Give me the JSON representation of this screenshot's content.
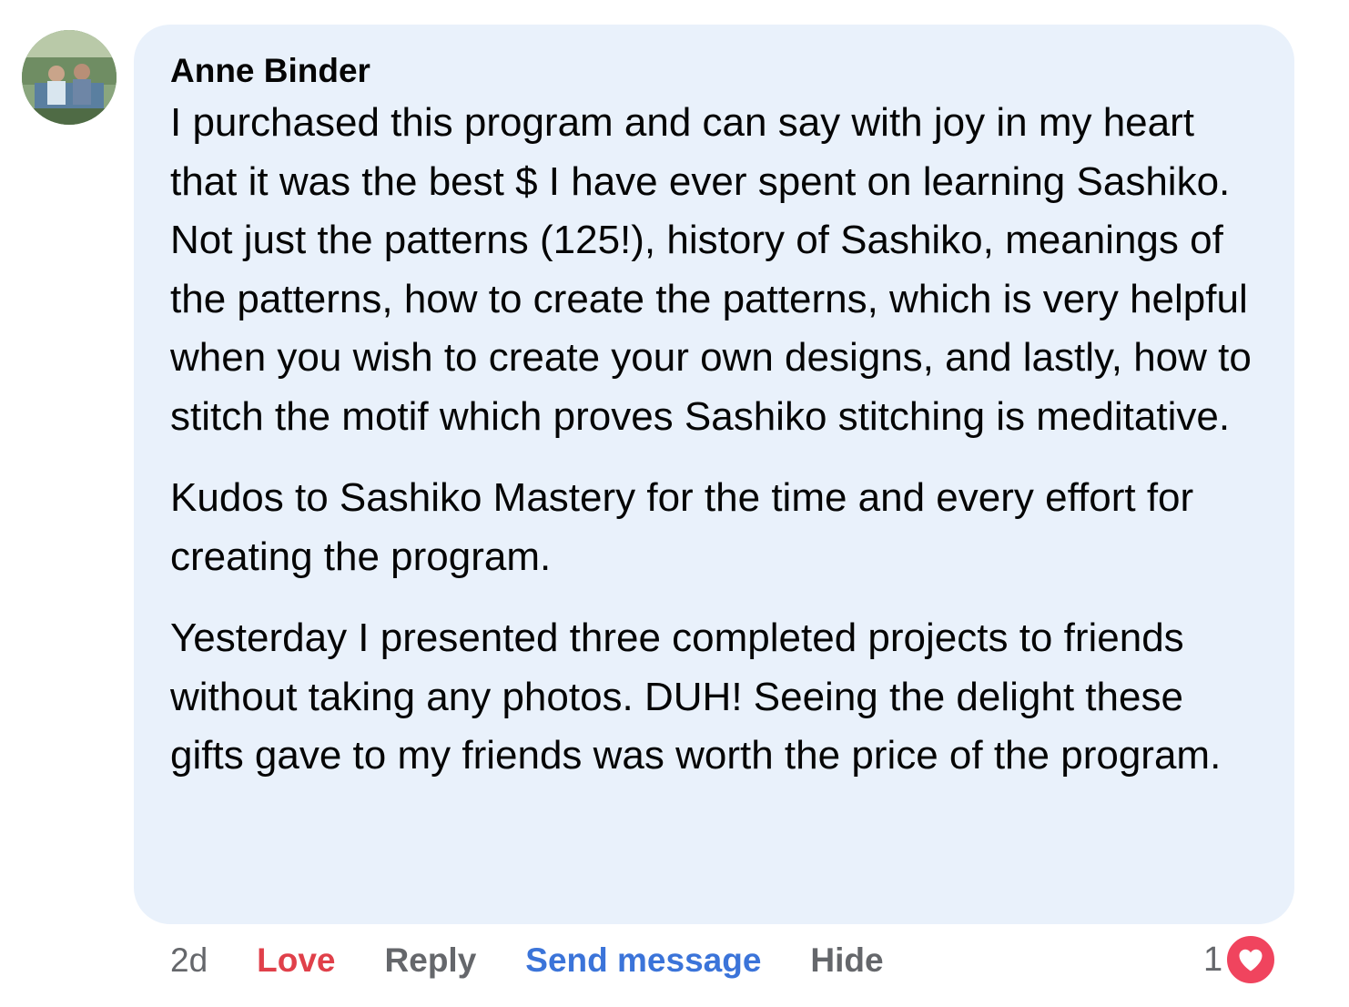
{
  "comment": {
    "author": "Anne Binder",
    "paragraphs": [
      "I purchased this program and can say with joy in my heart that it was the best $ I have ever spent on learning Sashiko. Not just the patterns (125!), history of Sashiko, meanings of the patterns, how to create the patterns, which is very helpful when you wish to create your own designs, and lastly, how to stitch the motif which proves Sashiko stitching is meditative.",
      "Kudos to Sashiko Mastery for the time and every effort for creating the program.",
      "Yesterday I presented three completed projects to friends without taking any photos. DUH! Seeing the delight these gifts gave to my friends was worth the price of the program."
    ]
  },
  "actions": {
    "time": "2d",
    "love_label": "Love",
    "reply_label": "Reply",
    "send_message_label": "Send message",
    "hide_label": "Hide"
  },
  "reactions": {
    "count": "1",
    "type_icon": "heart-icon"
  },
  "colors": {
    "bubble_bg": "#e9f1fb",
    "love": "#e0404a",
    "link": "#3b74d9",
    "secondary_text": "#65676b",
    "heart_badge": "#f0445e"
  }
}
